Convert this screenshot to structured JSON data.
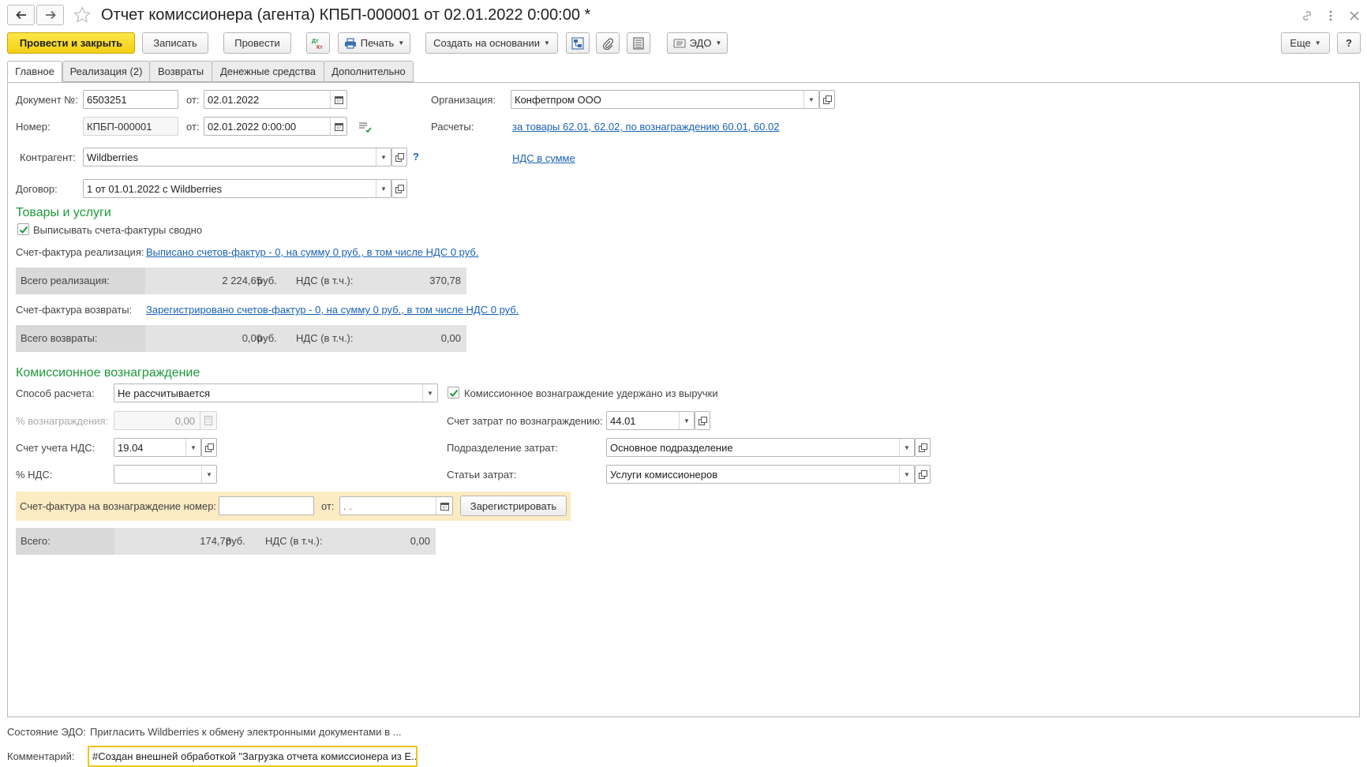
{
  "window": {
    "title": "Отчет комиссионера (агента) КПБП-000001 от 02.01.2022 0:00:00 *"
  },
  "toolbar": {
    "post_close": "Провести и закрыть",
    "save": "Записать",
    "post": "Провести",
    "dt_kt": "ДтКт",
    "print": "Печать",
    "create_based": "Создать на основании",
    "edo": "ЭДО",
    "more": "Еще",
    "help": "?"
  },
  "tabs": [
    {
      "label": "Главное"
    },
    {
      "label": "Реализация (2)"
    },
    {
      "label": "Возвраты"
    },
    {
      "label": "Денежные средства"
    },
    {
      "label": "Дополнительно"
    }
  ],
  "header": {
    "doc_no_label": "Документ №:",
    "doc_no_value": "6503251",
    "from_label": "от:",
    "doc_date": "02.01.2022",
    "number_label": "Номер:",
    "number_value": "КПБП-000001",
    "datetime_value": "02.01.2022  0:00:00",
    "counterparty_label": "Контрагент:",
    "counterparty_value": "Wildberries",
    "help_mark": "?",
    "contract_label": "Договор:",
    "contract_value": "1 от 01.01.2022 с Wildberries",
    "org_label": "Организация:",
    "org_value": "Конфетпром ООО",
    "settlements_label": "Расчеты:",
    "settlements_link": "за товары 62.01, 62.02, по вознаграждению 60.01, 60.02",
    "vat_link": "НДС в сумме"
  },
  "goods": {
    "title": "Товары и услуги",
    "summary_invoices_label": "Выписывать счета-фактуры сводно",
    "summary_invoices_checked": true,
    "sales_invoice_label": "Счет-фактура реализация:",
    "sales_invoice_link": "Выписано счетов-фактур - 0, на сумму 0 руб., в том числе НДС 0 руб.",
    "sales_total_label": "Всего реализация:",
    "sales_total_value": "2 224,65",
    "currency": "руб.",
    "vat_incl_label": "НДС (в т.ч.):",
    "sales_vat_value": "370,78",
    "returns_invoice_label": "Счет-фактура возвраты:",
    "returns_invoice_link": "Зарегистрировано счетов-фактур - 0, на сумму 0 руб., в том числе НДС 0 руб.",
    "returns_total_label": "Всего возвраты:",
    "returns_total_value": "0,00",
    "returns_vat_value": "0,00"
  },
  "commission": {
    "title": "Комиссионное вознаграждение",
    "calc_method_label": "Способ расчета:",
    "calc_method_value": "Не рассчитывается",
    "withheld_label": "Комиссионное вознаграждение удержано из выручки",
    "withheld_checked": true,
    "percent_label": "% вознаграждения:",
    "percent_value": "0,00",
    "cost_account_label": "Счет затрат по вознаграждению:",
    "cost_account_value": "44.01",
    "vat_account_label": "Счет учета НДС:",
    "vat_account_value": "19.04",
    "cost_dept_label": "Подразделение затрат:",
    "cost_dept_value": "Основное подразделение",
    "vat_percent_label": "% НДС:",
    "vat_percent_value": "",
    "cost_items_label": "Статьи затрат:",
    "cost_items_value": "Услуги комиссионеров",
    "invoice_no_label": "Счет-фактура на вознаграждение номер:",
    "invoice_no_value": "",
    "invoice_from_label": "от:",
    "invoice_date_value": "  .  .",
    "register_button": "Зарегистрировать",
    "total_label": "Всего:",
    "total_value": "174,78",
    "currency": "руб.",
    "vat_incl_label": "НДС (в т.ч.):",
    "vat_value": "0,00"
  },
  "footer": {
    "edo_state_label": "Состояние ЭДО:",
    "edo_state_value": "Пригласить Wildberries к обмену электронными документами в ...",
    "comment_label": "Комментарий:",
    "comment_value": "#Создан внешней обработкой \"Загрузка отчета комиссионера из E..."
  }
}
